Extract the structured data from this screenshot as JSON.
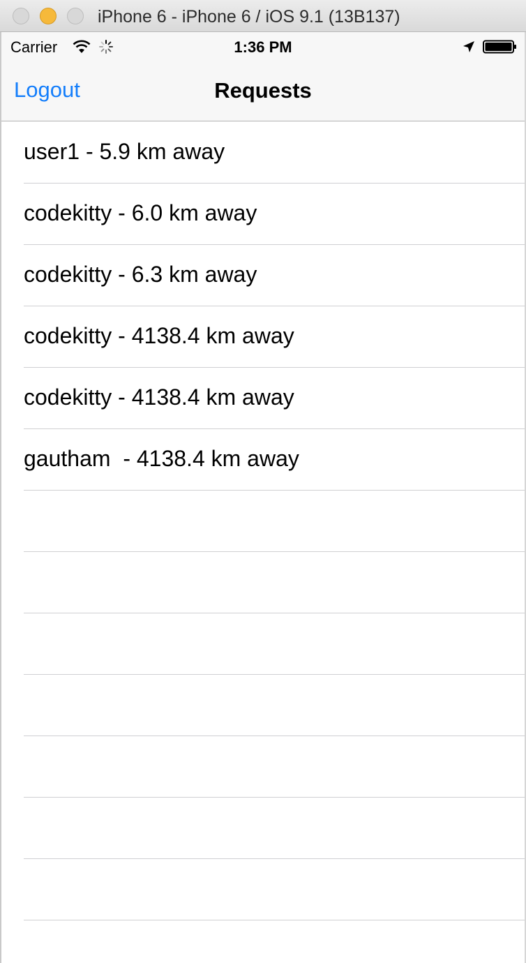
{
  "window": {
    "title": "iPhone 6 - iPhone 6 / iOS 9.1 (13B137)"
  },
  "status_bar": {
    "carrier": "Carrier",
    "time": "1:36 PM",
    "icons": [
      "wifi-icon",
      "activity-spinner-icon",
      "location-arrow-icon",
      "battery-icon"
    ]
  },
  "nav": {
    "left_button": "Logout",
    "title": "Requests",
    "tint_color": "#147efb"
  },
  "table": {
    "rows": [
      "user1 - 5.9 km away",
      "codekitty - 6.0 km away",
      "codekitty - 6.3 km away",
      "codekitty - 4138.4 km away",
      "codekitty - 4138.4 km away",
      "gautham  - 4138.4 km away",
      "",
      "",
      "",
      "",
      "",
      "",
      "",
      ""
    ]
  }
}
